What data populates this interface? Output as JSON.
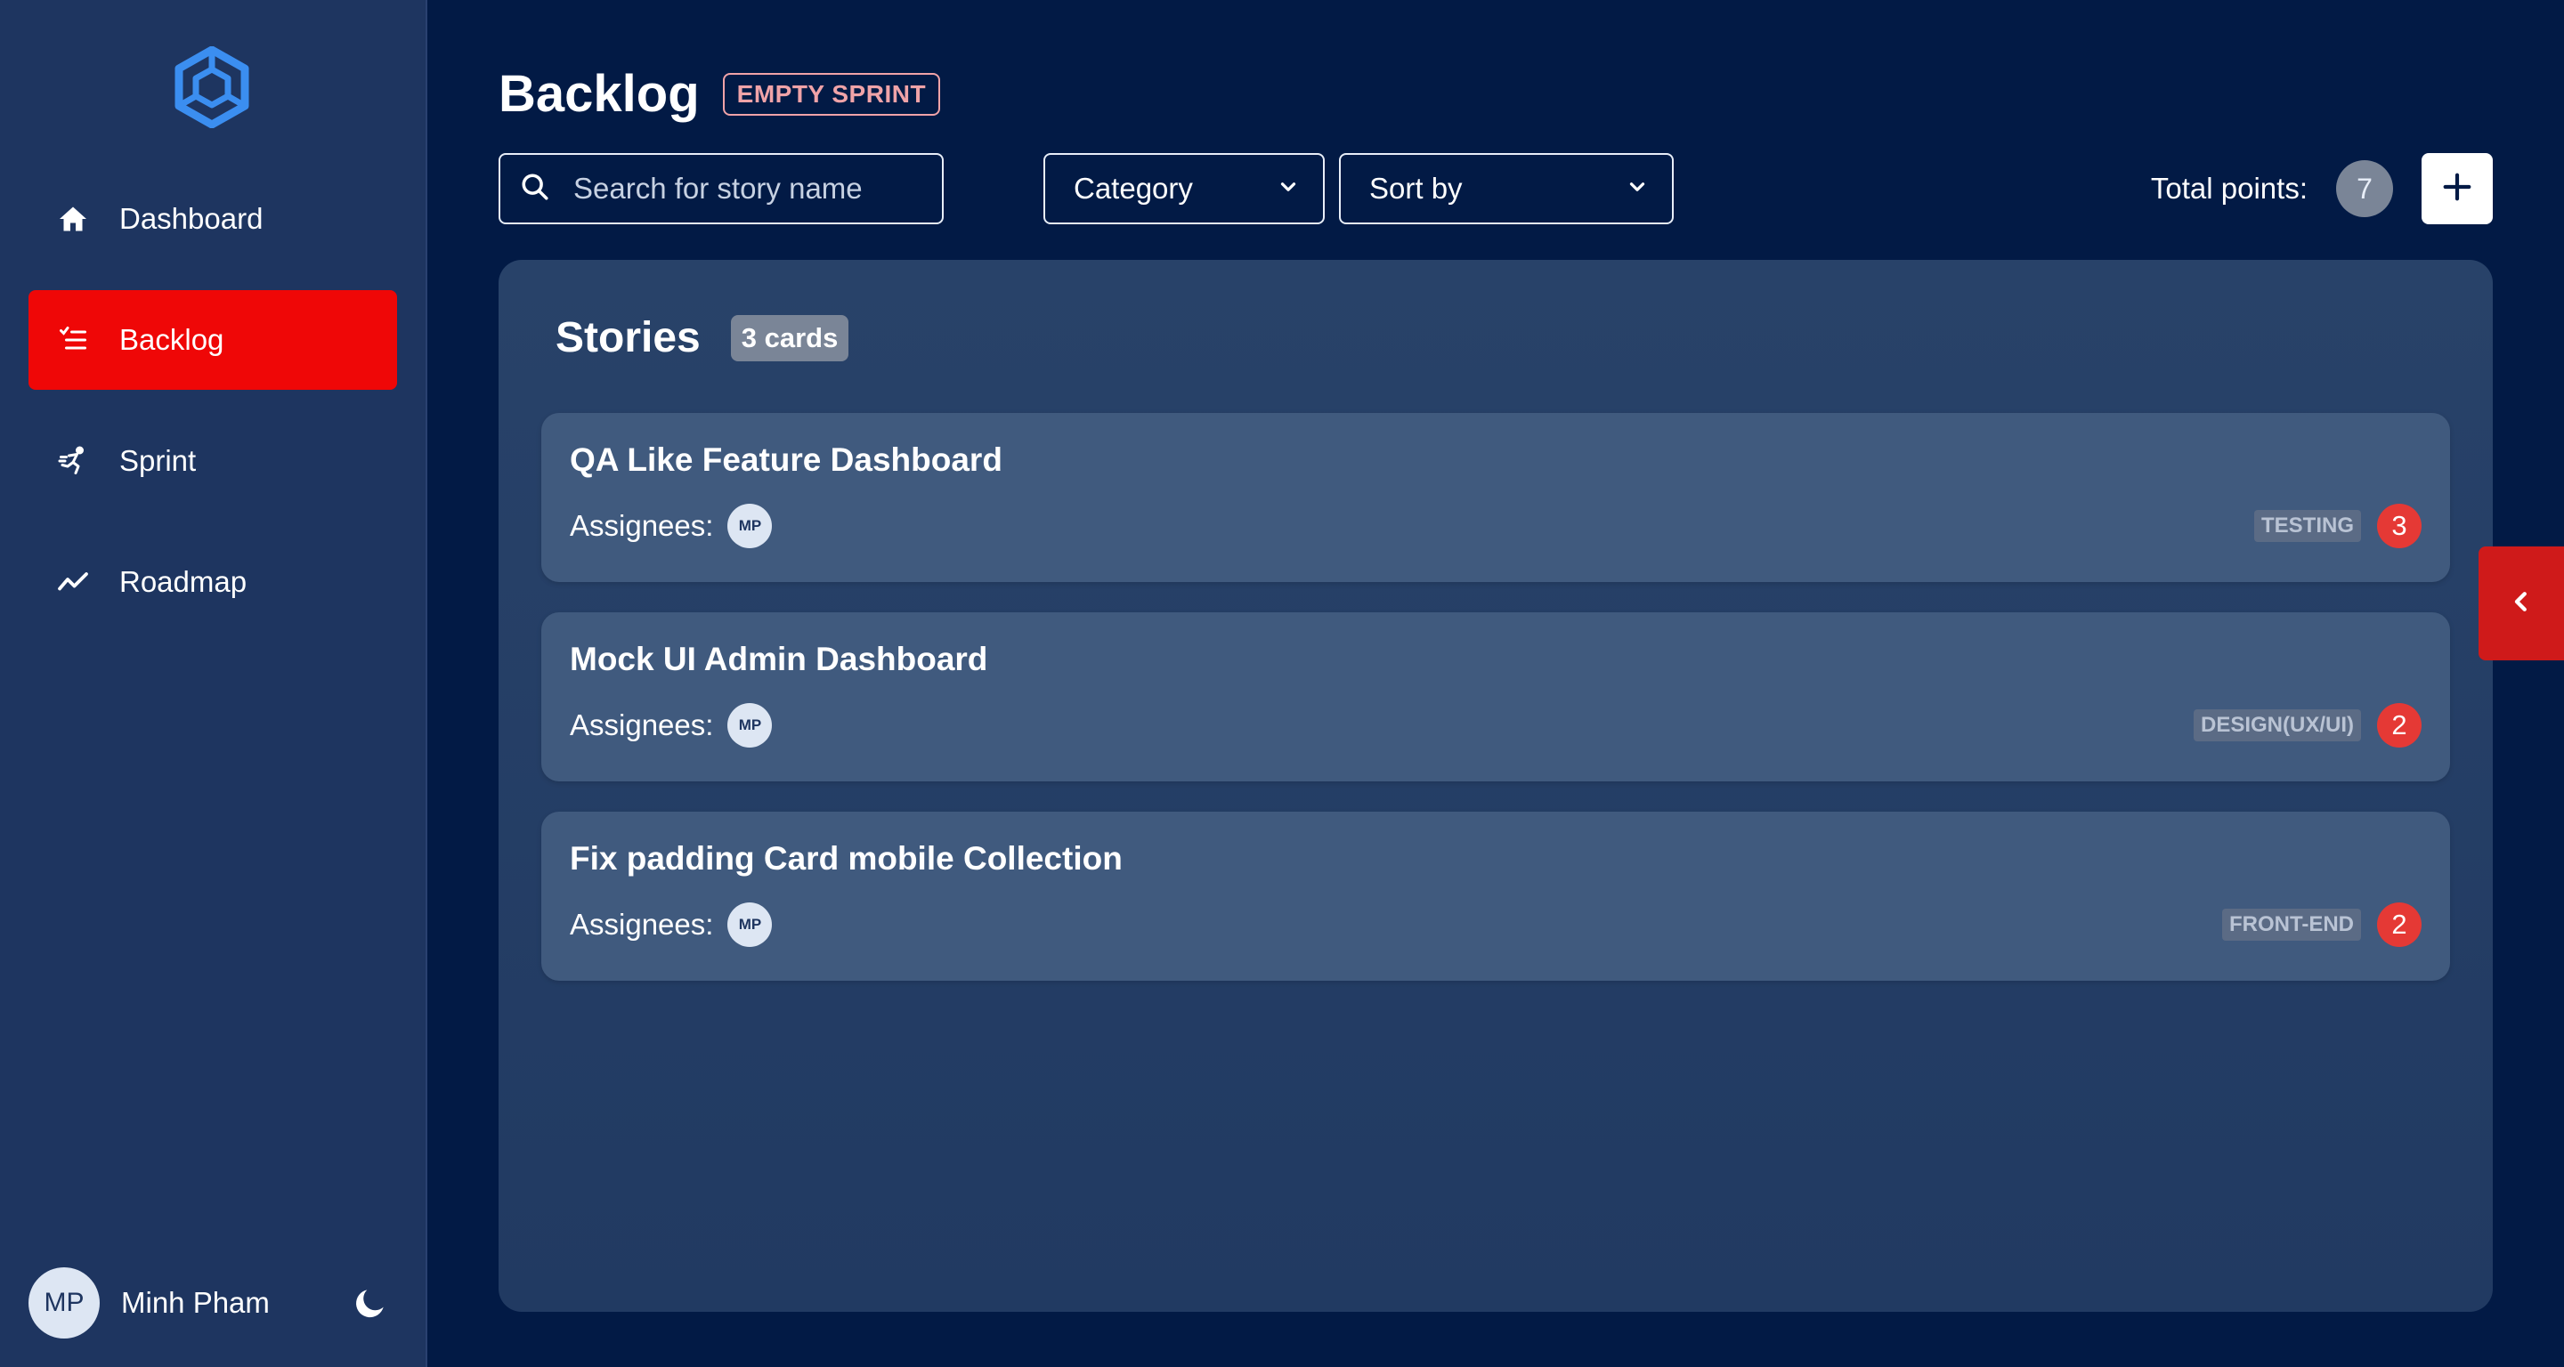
{
  "sidebar": {
    "logo_icon": "hexagon-cube-icon",
    "items": [
      {
        "label": "Dashboard",
        "icon": "home-icon",
        "active": false
      },
      {
        "label": "Backlog",
        "icon": "list-check-icon",
        "active": true
      },
      {
        "label": "Sprint",
        "icon": "running-icon",
        "active": false
      },
      {
        "label": "Roadmap",
        "icon": "trend-line-icon",
        "active": false
      }
    ],
    "user": {
      "initials": "MP",
      "name": "Minh Pham"
    },
    "theme_toggle_icon": "moon-icon"
  },
  "header": {
    "title": "Backlog",
    "sprint_badge": "EMPTY SPRINT"
  },
  "toolbar": {
    "search_placeholder": "Search for story name",
    "category_label": "Category",
    "sort_label": "Sort by",
    "total_points_label": "Total points:",
    "total_points_value": "7"
  },
  "board": {
    "title": "Stories",
    "count_label": "3 cards",
    "cards": [
      {
        "title": "QA Like Feature Dashboard",
        "assignees_label": "Assignees:",
        "assignee_initials": "MP",
        "tag": "TESTING",
        "points": "3"
      },
      {
        "title": "Mock UI Admin Dashboard",
        "assignees_label": "Assignees:",
        "assignee_initials": "MP",
        "tag": "DESIGN(UX/UI)",
        "points": "2"
      },
      {
        "title": "Fix padding Card mobile Collection",
        "assignees_label": "Assignees:",
        "assignee_initials": "MP",
        "tag": "FRONT-END",
        "points": "2"
      }
    ]
  },
  "colors": {
    "background": "#021a45",
    "sidebar": "#1e3560",
    "active_nav": "#ef0707",
    "card": "#405a7e",
    "points_badge": "#e53935",
    "logo": "#3b8ef0"
  }
}
